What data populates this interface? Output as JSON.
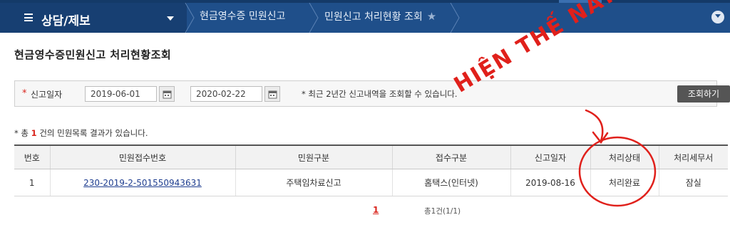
{
  "nav": {
    "menu_title": "상담/제보",
    "breadcrumb": [
      "현금영수증 민원신고",
      "민원신고 처리현황 조회"
    ]
  },
  "page_title": "현금영수증민원신고 처리현황조회",
  "search": {
    "required_mark": "*",
    "label": "신고일자",
    "start_date": "2019-06-01",
    "end_date": "2020-02-22",
    "range_sep": "~",
    "notice": "* 최근 2년간 신고내역을 조회할 수 있습니다.",
    "button": "조회하기"
  },
  "result": {
    "prefix": "* 총 ",
    "count": "1",
    "suffix": " 건의 민원목록 결과가 있습니다."
  },
  "table": {
    "headers": [
      "번호",
      "민원접수번호",
      "민원구분",
      "접수구분",
      "신고일자",
      "처리상태",
      "처리세무서"
    ],
    "rows": [
      [
        "1",
        "230-2019-2-501550943631",
        "주택임차료신고",
        "홈택스(인터넷)",
        "2019-08-16",
        "처리완료",
        "잠실"
      ]
    ]
  },
  "pagination": {
    "current": "1",
    "summary": "총1건(1/1)"
  },
  "annotation": {
    "text": "HIỆN THẾ NÀY LÀ OK",
    "color": "#e0201b"
  },
  "colors": {
    "nav_bg": "#1f4f8a",
    "accent_red": "#d9251d",
    "button_bg": "#555555"
  }
}
